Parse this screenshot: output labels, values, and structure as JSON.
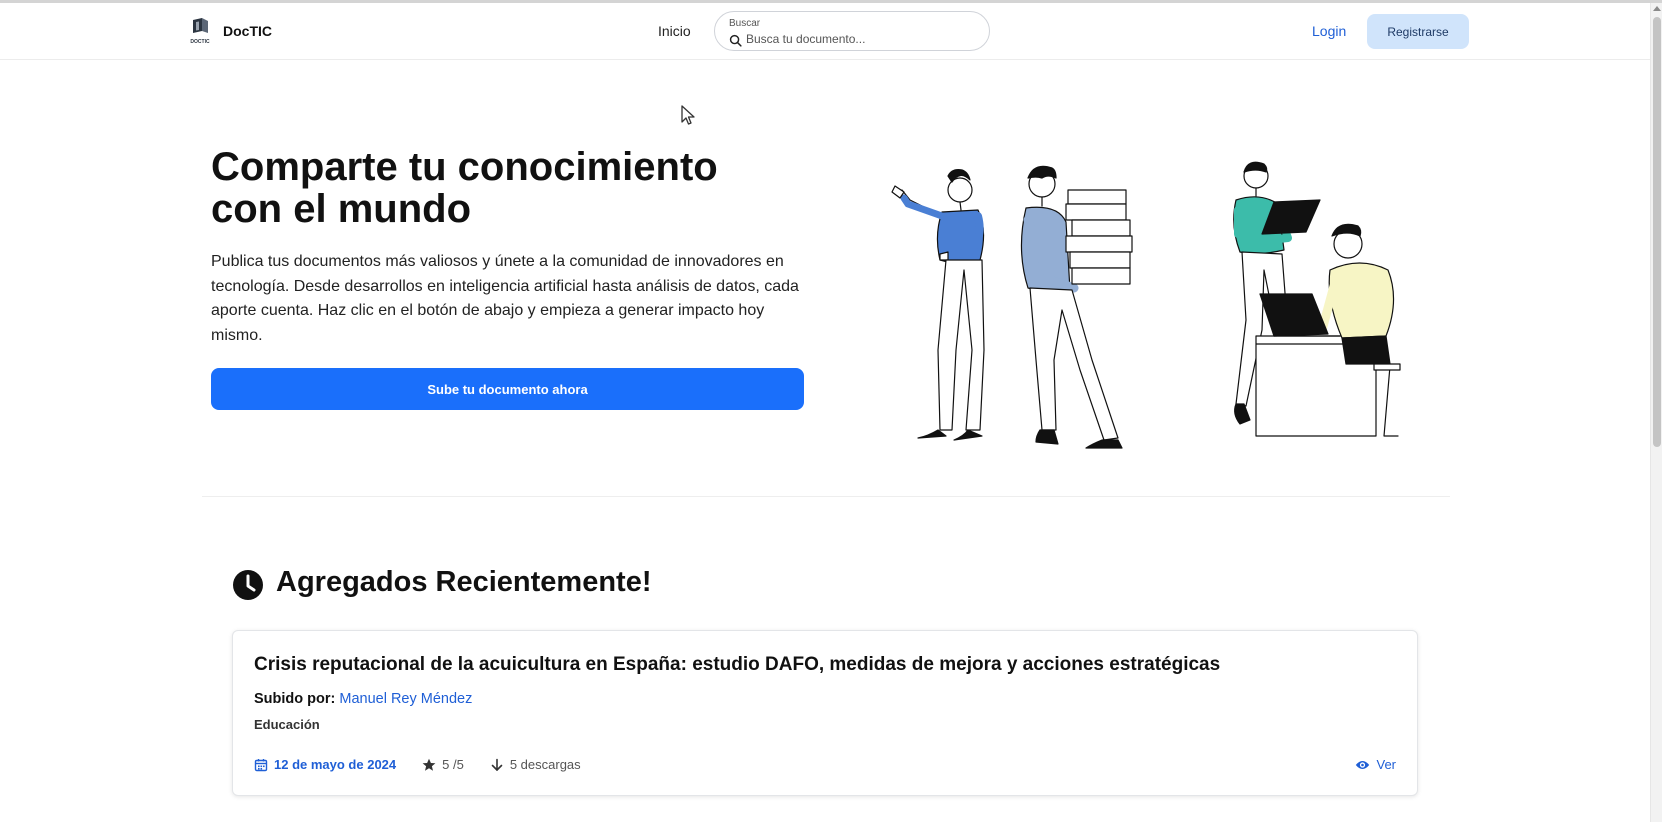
{
  "nav": {
    "brand_name": "DocTIC",
    "logo_text": "DOCTIC",
    "inicio": "Inicio",
    "search_label": "Buscar",
    "search_placeholder": "Busca tu documento...",
    "login": "Login",
    "register": "Registrarse"
  },
  "hero": {
    "title_line1": "Comparte tu conocimiento",
    "title_line2": "con el mundo",
    "description": "Publica tus documentos más valiosos y únete a la comunidad de innovadores en tecnología. Desde desarrollos en inteligencia artificial hasta análisis de datos, cada aporte cuenta. Haz clic en el botón de abajo y empieza a generar impacto hoy mismo.",
    "cta": "Sube tu documento ahora"
  },
  "recent": {
    "title": "Agregados Recientemente!",
    "icon": "clock-icon",
    "documents": [
      {
        "title": "Crisis reputacional de la acuicultura en España: estudio DAFO, medidas de mejora y acciones estratégicas",
        "uploaded_by_label": "Subido por:",
        "uploader": "Manuel Rey Méndez",
        "category": "Educación",
        "date": "12 de mayo de 2024",
        "rating": "5 /5",
        "downloads": "5 descargas",
        "view_label": "Ver"
      }
    ]
  },
  "colors": {
    "accent": "#1a6ffb",
    "link": "#1f5fd6",
    "register_bg": "#d0e4fb",
    "teal": "#3cbcaa",
    "blue_jacket": "#4a7fd4",
    "yellow_shirt": "#f7f5c5"
  }
}
